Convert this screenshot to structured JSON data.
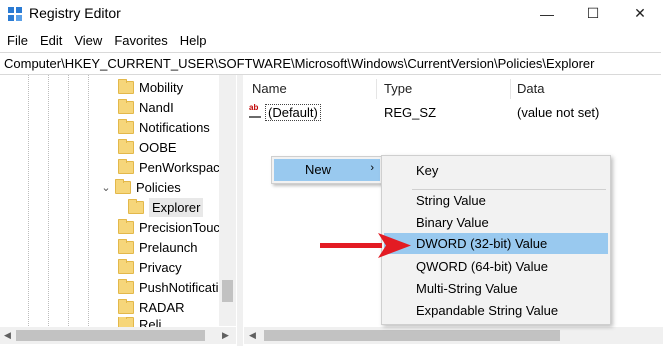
{
  "window": {
    "title": "Registry Editor",
    "minimize_glyph": "—",
    "maximize_glyph": "☐",
    "close_glyph": "✕"
  },
  "menu": [
    "File",
    "Edit",
    "View",
    "Favorites",
    "Help"
  ],
  "address": "Computer\\HKEY_CURRENT_USER\\SOFTWARE\\Microsoft\\Windows\\CurrentVersion\\Policies\\Explorer",
  "tree": {
    "items": [
      {
        "label": "Mobility"
      },
      {
        "label": "NandI"
      },
      {
        "label": "Notifications"
      },
      {
        "label": "OOBE"
      },
      {
        "label": "PenWorkspace"
      },
      {
        "label": "Policies",
        "expanded": true
      },
      {
        "label": "Explorer",
        "selected": true
      },
      {
        "label": "PrecisionTouch"
      },
      {
        "label": "Prelaunch"
      },
      {
        "label": "Privacy"
      },
      {
        "label": "PushNotification"
      },
      {
        "label": "RADAR"
      },
      {
        "label": "Reli..."
      }
    ]
  },
  "list": {
    "columns": [
      "Name",
      "Type",
      "Data"
    ],
    "rows": [
      {
        "name": "(Default)",
        "type": "REG_SZ",
        "data": "(value not set)",
        "icon": "string-value-icon"
      }
    ]
  },
  "context_menu": {
    "new_label": "New",
    "submenu": {
      "items": [
        "Key",
        "String Value",
        "Binary Value",
        "DWORD (32-bit) Value",
        "QWORD (64-bit) Value",
        "Multi-String Value",
        "Expandable String Value"
      ],
      "highlighted": "DWORD (32-bit) Value"
    }
  },
  "colors": {
    "highlight": "#99c9ef",
    "menu_bg": "#f2f2f2",
    "annotation_arrow": "#e31b23",
    "folder": "#f6d67a"
  }
}
